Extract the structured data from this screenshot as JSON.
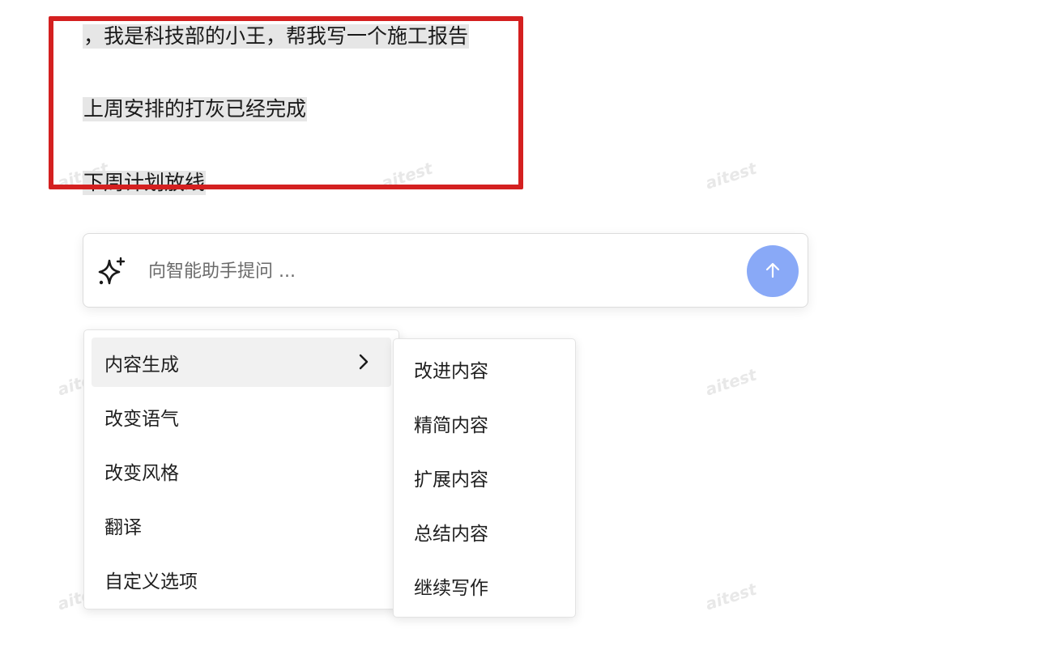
{
  "document": {
    "lines": [
      "，我是科技部的小王，帮我写一个施工报告",
      "上周安排的打灰已经完成",
      "下周计划放线"
    ]
  },
  "watermark": {
    "text": "aitest"
  },
  "ai_bar": {
    "placeholder": "向智能助手提问 ...",
    "sparkle_icon": "sparkle-icon",
    "send_icon": "arrow-up-icon",
    "send_color": "#89a9f7"
  },
  "main_menu": {
    "items": [
      {
        "label": "内容生成",
        "has_submenu": true
      },
      {
        "label": "改变语气"
      },
      {
        "label": "改变风格"
      },
      {
        "label": "翻译"
      },
      {
        "label": "自定义选项"
      }
    ]
  },
  "sub_menu": {
    "items": [
      {
        "label": "改进内容"
      },
      {
        "label": "精简内容"
      },
      {
        "label": "扩展内容"
      },
      {
        "label": "总结内容"
      },
      {
        "label": "继续写作"
      }
    ]
  },
  "annotation": {
    "box_color": "#d42020"
  }
}
